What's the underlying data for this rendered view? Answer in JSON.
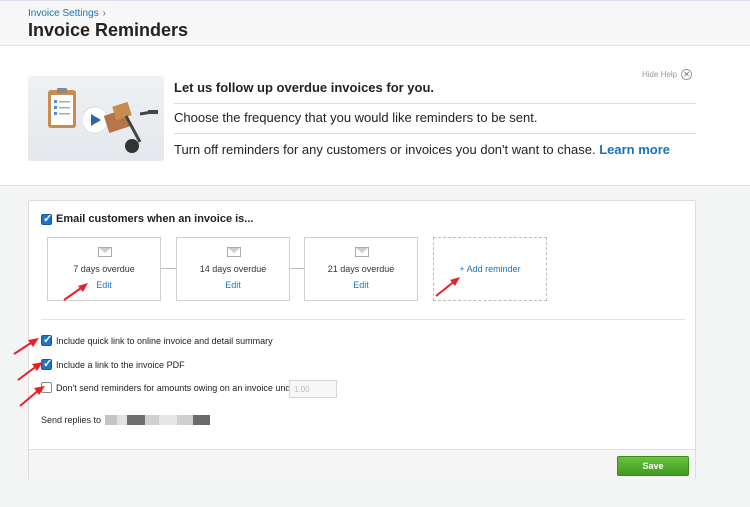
{
  "breadcrumb": {
    "parent": "Invoice Settings",
    "separator": "›"
  },
  "page_title": "Invoice Reminders",
  "help": {
    "hide_label": "Hide Help",
    "line1": "Let us follow up overdue invoices for you.",
    "line2": "Choose the frequency that you would like reminders to be sent.",
    "line3": "Turn off reminders for any customers or invoices you don't want to chase.",
    "learn_more": "Learn more"
  },
  "email_customers": {
    "label": "Email customers when an invoice is...",
    "checked": true
  },
  "reminders": [
    {
      "label": "7 days overdue",
      "edit": "Edit"
    },
    {
      "label": "14 days overdue",
      "edit": "Edit"
    },
    {
      "label": "21 days overdue",
      "edit": "Edit"
    }
  ],
  "add_reminder": "+ Add reminder",
  "options": [
    {
      "label": "Include quick link to online invoice and detail summary",
      "checked": true
    },
    {
      "label": "Include a link to the invoice PDF",
      "checked": true
    },
    {
      "label": "Don't send reminders for amounts owing on an invoice under",
      "checked": false
    }
  ],
  "amount_placeholder": "1.00",
  "send_replies_label": "Send replies to",
  "save_label": "Save",
  "colors": {
    "accent": "#1a73b8",
    "save_green": "#4caf2a",
    "arrow_red": "#e8202a"
  }
}
